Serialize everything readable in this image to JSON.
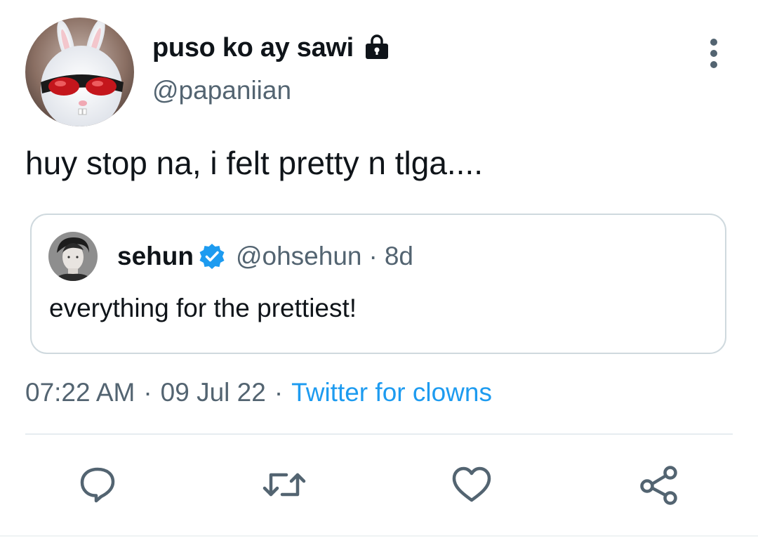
{
  "author": {
    "display_name": "puso ko ay sawi",
    "handle": "@papaniian",
    "protected_icon": "lock-icon",
    "avatar_icon": "bunny-with-red-sunglasses-avatar"
  },
  "tweet": {
    "text": "huy stop na, i felt pretty n tlga...."
  },
  "quoted_tweet": {
    "display_name": "sehun",
    "verified_icon": "verified-badge-icon",
    "handle": "@ohsehun",
    "separator": "·",
    "time": "8d",
    "text": "everything for the prettiest!"
  },
  "meta": {
    "time": "07:22 AM",
    "separator": "·",
    "date": "09 Jul 22",
    "source": "Twitter for clowns"
  },
  "actions": {
    "reply_icon": "reply-icon",
    "retweet_icon": "retweet-icon",
    "like_icon": "heart-icon",
    "share_icon": "share-icon"
  },
  "colors": {
    "accent": "#1d9bf0",
    "text_primary": "#0f1419",
    "text_secondary": "#536471",
    "icon_gray": "#536471",
    "border": "#cfd9de"
  }
}
